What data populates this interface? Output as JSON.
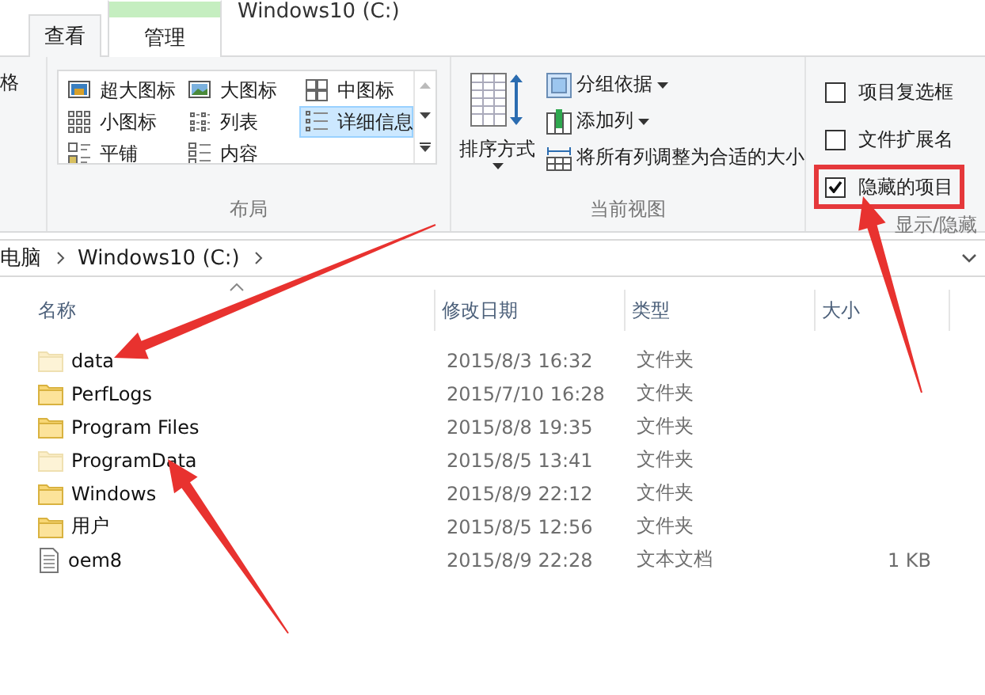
{
  "window": {
    "title": "Windows10 (C:)"
  },
  "tabs": [
    {
      "label": "查看",
      "selected": true,
      "contextual": false
    },
    {
      "label": "管理",
      "selected": false,
      "contextual": true
    }
  ],
  "ribbon": {
    "cut_group": {
      "label": "格"
    },
    "layout": {
      "label": "布局",
      "options": [
        {
          "label": "超大图标",
          "selected": false
        },
        {
          "label": "大图标",
          "selected": false
        },
        {
          "label": "中图标",
          "selected": false
        },
        {
          "label": "小图标",
          "selected": false
        },
        {
          "label": "列表",
          "selected": false
        },
        {
          "label": "详细信息",
          "selected": true
        },
        {
          "label": "平铺",
          "selected": false
        },
        {
          "label": "内容",
          "selected": false
        }
      ]
    },
    "current_view": {
      "label": "当前视图",
      "sort": {
        "label": "排序方式"
      },
      "commands": [
        {
          "label": "分组依据",
          "dropdown": true
        },
        {
          "label": "添加列",
          "dropdown": true
        },
        {
          "label": "将所有列调整为合适的大小",
          "dropdown": false
        }
      ]
    },
    "show_hide": {
      "label": "显示/隐藏",
      "options": [
        {
          "label": "项目复选框",
          "checked": false,
          "highlighted": false
        },
        {
          "label": "文件扩展名",
          "checked": false,
          "highlighted": false
        },
        {
          "label": "隐藏的项目",
          "checked": true,
          "highlighted": true
        }
      ]
    }
  },
  "address": {
    "crumbs": [
      "电脑",
      "Windows10 (C:)"
    ]
  },
  "files": {
    "columns": [
      {
        "label": "名称",
        "sorted": true
      },
      {
        "label": "修改日期",
        "sorted": false
      },
      {
        "label": "类型",
        "sorted": false
      },
      {
        "label": "大小",
        "sorted": false
      }
    ],
    "rows": [
      {
        "name": "data",
        "date": "2015/8/3 16:32",
        "type": "文件夹",
        "kind": "folder",
        "hidden": true
      },
      {
        "name": "PerfLogs",
        "date": "2015/7/10 16:28",
        "type": "文件夹",
        "kind": "folder",
        "hidden": false
      },
      {
        "name": "Program Files",
        "date": "2015/8/8 19:35",
        "type": "文件夹",
        "kind": "folder",
        "hidden": false
      },
      {
        "name": "ProgramData",
        "date": "2015/8/5 13:41",
        "type": "文件夹",
        "kind": "folder",
        "hidden": true
      },
      {
        "name": "Windows",
        "date": "2015/8/9 22:12",
        "type": "文件夹",
        "kind": "folder",
        "hidden": false
      },
      {
        "name": "用户",
        "date": "2015/8/5 12:56",
        "type": "文件夹",
        "kind": "folder",
        "hidden": false
      },
      {
        "name": "oem8",
        "date": "2015/8/9 22:28",
        "type": "文本文档",
        "size": "1 KB",
        "kind": "text",
        "hidden": false
      }
    ]
  }
}
